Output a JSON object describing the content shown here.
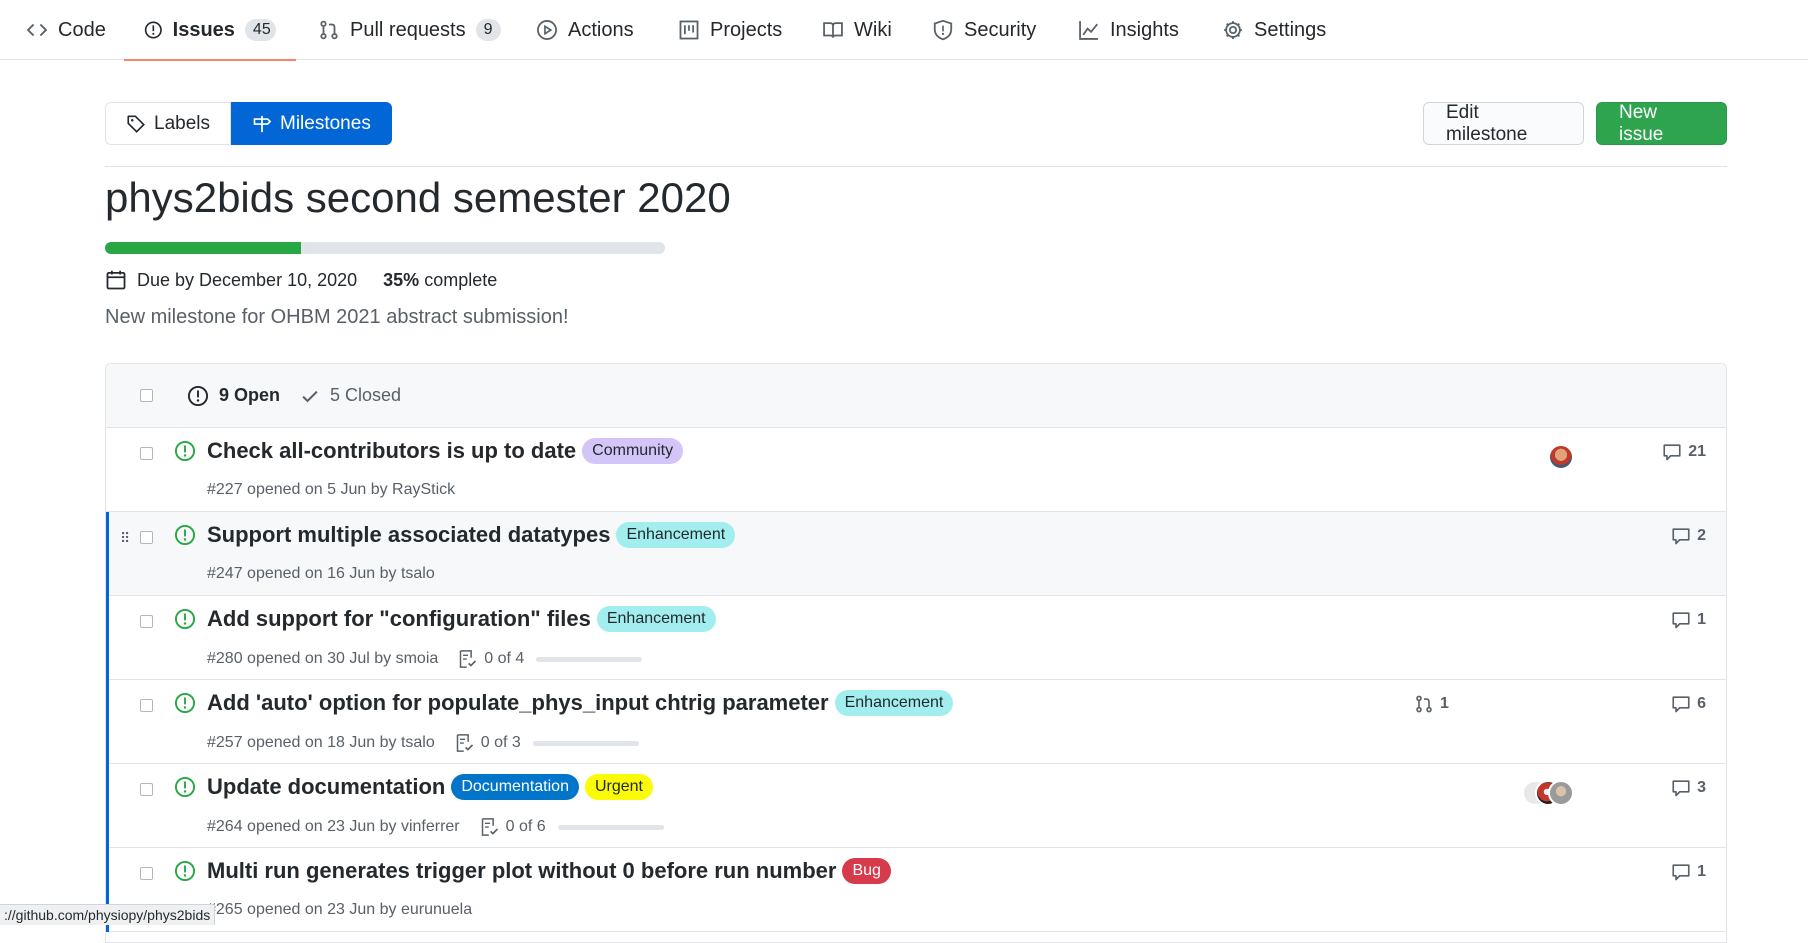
{
  "repo_nav": {
    "code": "Code",
    "issues": "Issues",
    "issues_count": "45",
    "pulls": "Pull requests",
    "pulls_count": "9",
    "actions": "Actions",
    "projects": "Projects",
    "wiki": "Wiki",
    "security": "Security",
    "insights": "Insights",
    "settings": "Settings"
  },
  "subnav": {
    "labels": "Labels",
    "milestones": "Milestones"
  },
  "buttons": {
    "edit_milestone": "Edit milestone",
    "new_issue": "New issue"
  },
  "milestone": {
    "title": "phys2bids second semester 2020",
    "progress_percent": 35,
    "due": "Due by December 10, 2020",
    "percent_text": "35%",
    "complete_text": "complete",
    "description": "New milestone for OHBM 2021 abstract submission!"
  },
  "issues_header": {
    "open": "9 Open",
    "closed": "5 Closed"
  },
  "issues": [
    {
      "title": "Check all-contributors is up to date",
      "labels": [
        {
          "name": "Community",
          "bg": "#d4c5f9",
          "fg": "#24292e"
        }
      ],
      "meta": "#227 opened on 5 Jun by RayStick",
      "comments": "21"
    },
    {
      "title": "Support multiple associated datatypes",
      "labels": [
        {
          "name": "Enhancement",
          "bg": "#a2eeef",
          "fg": "#24292e"
        }
      ],
      "meta": "#247 opened on 16 Jun by tsalo",
      "comments": "2"
    },
    {
      "title": "Add support for \"configuration\" files",
      "labels": [
        {
          "name": "Enhancement",
          "bg": "#a2eeef",
          "fg": "#24292e"
        }
      ],
      "meta": "#280 opened on 30 Jul by smoia",
      "tasks": "0 of 4",
      "comments": "1"
    },
    {
      "title": "Add 'auto' option for populate_phys_input chtrig parameter",
      "labels": [
        {
          "name": "Enhancement",
          "bg": "#a2eeef",
          "fg": "#24292e"
        }
      ],
      "meta": "#257 opened on 18 Jun by tsalo",
      "tasks": "0 of 3",
      "linked_prs": "1",
      "comments": "6"
    },
    {
      "title": "Update documentation",
      "labels": [
        {
          "name": "Documentation",
          "bg": "#0075ca",
          "fg": "#ffffff"
        },
        {
          "name": "Urgent",
          "bg": "#fbfb07",
          "fg": "#24292e"
        }
      ],
      "meta": "#264 opened on 23 Jun by vinferrer",
      "tasks": "0 of 6",
      "comments": "3"
    },
    {
      "title": "Multi run generates trigger plot without 0 before run number",
      "labels": [
        {
          "name": "Bug",
          "bg": "#d73a4a",
          "fg": "#ffffff"
        }
      ],
      "meta": "#265 opened on 23 Jun by eurunuela",
      "comments": "1"
    }
  ],
  "status_bar": "://github.com/physiopy/phys2bids",
  "colors": {
    "accent": "#0366d6",
    "open_green": "#28a745",
    "primary_button": "#2ea44f",
    "tab_underline": "#f9826c"
  }
}
